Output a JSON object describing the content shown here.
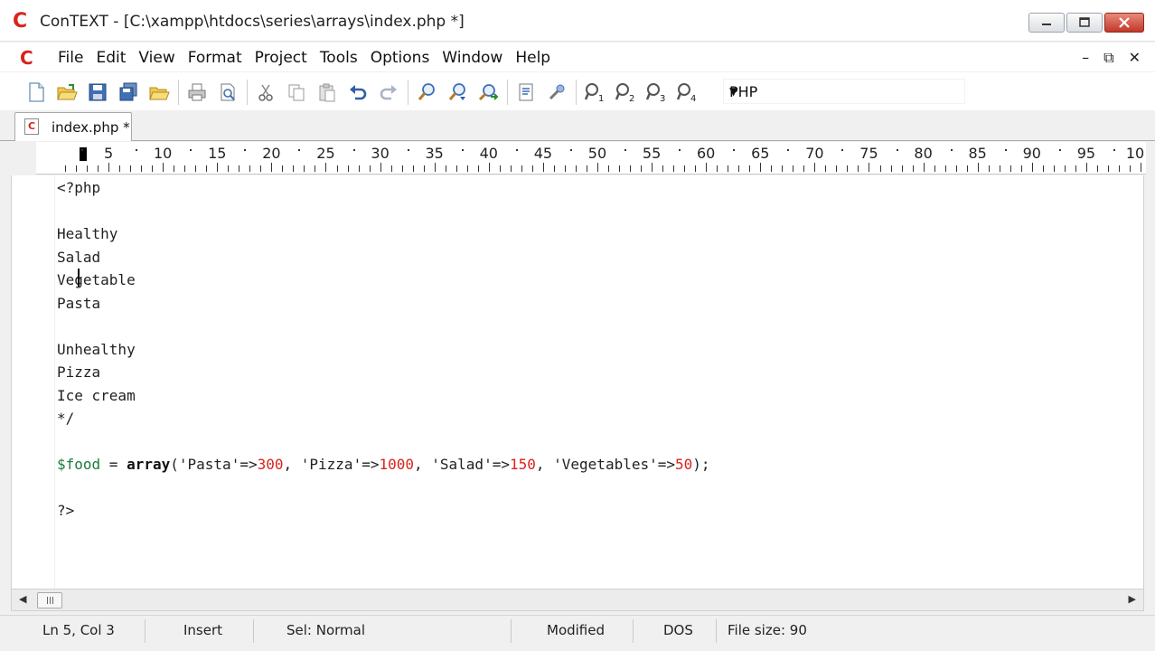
{
  "window": {
    "title": "ConTEXT - [C:\\xampp\\htdocs\\series\\arrays\\index.php *]",
    "logo_letter": "C"
  },
  "menu": {
    "items": [
      "File",
      "Edit",
      "View",
      "Format",
      "Project",
      "Tools",
      "Options",
      "Window",
      "Help"
    ],
    "mdi_minimize": "–",
    "mdi_restore": "⧉",
    "mdi_close": "✕"
  },
  "toolbar": {
    "icons": [
      "new-file-icon",
      "open-folder-icon",
      "save-icon",
      "save-all-icon",
      "open-project-icon",
      "print-icon",
      "print-preview-icon",
      "cut-icon",
      "copy-icon",
      "paste-icon",
      "undo-icon",
      "redo-icon",
      "find-icon",
      "find-next-icon",
      "replace-icon",
      "output-icon",
      "tools-icon",
      "user-command-1-icon",
      "user-command-2-icon",
      "user-command-3-icon",
      "user-command-4-icon"
    ],
    "language_selected": "PHP"
  },
  "tab": {
    "label": "index.php *"
  },
  "ruler": {
    "labels": [
      "5",
      "10",
      "15",
      "20",
      "25",
      "30",
      "35",
      "40",
      "45",
      "50",
      "55",
      "60",
      "65",
      "70",
      "75",
      "80",
      "85",
      "90",
      "95",
      "10"
    ]
  },
  "editor": {
    "lines": [
      "<?php",
      "",
      "Healthy",
      "Salad",
      "Vegetable",
      "Pasta",
      "",
      "Unhealthy",
      "Pizza",
      "Ice cream",
      "*/",
      "",
      "CODE_LINE",
      "",
      "?>"
    ],
    "code_line": {
      "var": "$food",
      "op1": " = ",
      "kw": "array",
      "p1": "(",
      "s1": "'Pasta'",
      "a1": "=>",
      "n1": "300",
      "c1": ", ",
      "s2": "'Pizza'",
      "a2": "=>",
      "n2": "1000",
      "c2": ", ",
      "s3": "'Salad'",
      "a3": "=>",
      "n3": "150",
      "c3": ", ",
      "s4": "'Vegetables'",
      "a4": "=>",
      "n4": "50",
      "end": ");"
    }
  },
  "status": {
    "position": "Ln 5, Col 3",
    "mode": "Insert",
    "selection": "Sel: Normal",
    "modified": "Modified",
    "line_endings": "DOS",
    "file_size": "File size: 90"
  }
}
